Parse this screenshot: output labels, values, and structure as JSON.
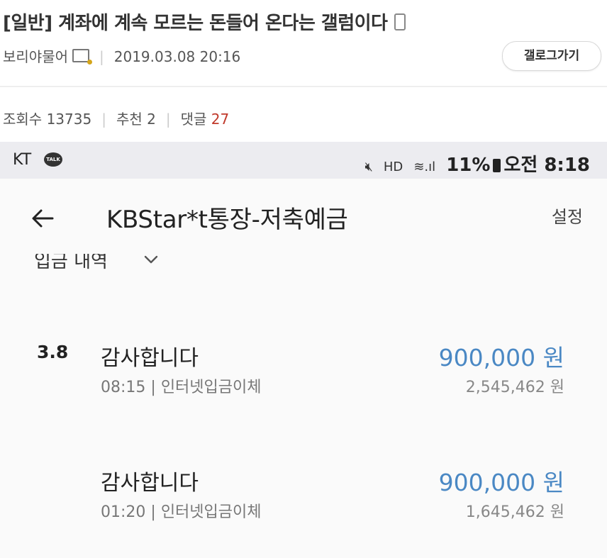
{
  "post": {
    "title": "[일반] 계좌에 계속 모르는 돈들어 온다는 갤럼이다",
    "author": "보리야물어",
    "date": "2019.03.08 20:16",
    "gallery_button": "갤로그가기",
    "stats": {
      "views_label": "조회수",
      "views": "13735",
      "recommend_label": "추천",
      "recommend": "2",
      "comments_label": "댓글",
      "comments": "27"
    }
  },
  "phone": {
    "status_bar": {
      "carrier": "KT",
      "talk_badge": "TALK",
      "icons_text": "HD",
      "battery_percent": "11%",
      "time": "오전 8:18"
    },
    "app_bar": {
      "title": "KBStar*t통장-저축예금",
      "settings": "설정"
    },
    "filter": {
      "label": "입금 내역"
    },
    "transactions": [
      {
        "date": "3.8",
        "name": "감사합니다",
        "time": "08:15",
        "type": "인터넷입금이체",
        "amount": "900,000 원",
        "balance": "2,545,462 원"
      },
      {
        "date": "",
        "name": "감사합니다",
        "time": "01:20",
        "type": "인터넷입금이체",
        "amount": "900,000 원",
        "balance": "1,645,462 원"
      }
    ]
  },
  "colors": {
    "amount_blue": "#4a88c4",
    "comment_red": "#c0392b",
    "status_bar_bg": "#ececf0"
  }
}
